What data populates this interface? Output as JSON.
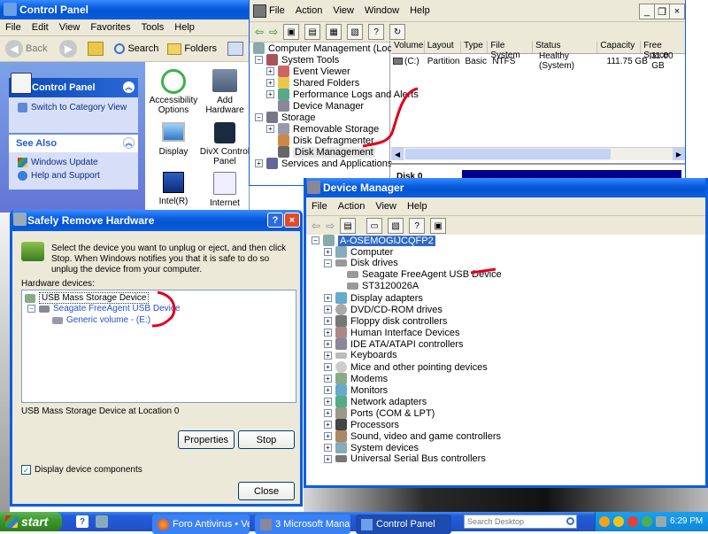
{
  "control_panel": {
    "title": "Control Panel",
    "menu": [
      "File",
      "Edit",
      "View",
      "Favorites",
      "Tools",
      "Help"
    ],
    "toolbar": {
      "back": "Back",
      "search": "Search",
      "folders": "Folders"
    },
    "side_panel": {
      "header": "Control Panel",
      "switch_link": "Switch to Category View"
    },
    "see_also": {
      "header": "See Also",
      "items": [
        "Windows Update",
        "Help and Support"
      ]
    },
    "items": [
      {
        "label": "Accessibility Options",
        "icon": "accessibility-icon"
      },
      {
        "label": "Add Hardware",
        "icon": "add-hardware-icon"
      },
      {
        "label": "Display",
        "icon": "display-icon"
      },
      {
        "label": "DivX Control Panel",
        "icon": "divx-icon"
      },
      {
        "label": "Intel(R)",
        "icon": "intel-icon"
      },
      {
        "label": "Internet",
        "icon": "internet-icon"
      }
    ]
  },
  "computer_mgmt": {
    "menu": [
      "File",
      "Action",
      "View",
      "Window",
      "Help"
    ],
    "tree": [
      "Computer Management (Local)",
      "System Tools",
      "Event Viewer",
      "Shared Folders",
      "Performance Logs and Alerts",
      "Device Manager",
      "Storage",
      "Removable Storage",
      "Disk Defragmenter",
      "Disk Management",
      "Services and Applications"
    ],
    "columns": [
      "Volume",
      "Layout",
      "Type",
      "File System",
      "Status",
      "Capacity",
      "Free Space"
    ],
    "rows": [
      [
        "(C:)",
        "Partition",
        "Basic",
        "NTFS",
        "Healthy (System)",
        "111.75 GB",
        "11.00 GB"
      ]
    ],
    "disk_label": "Disk 0"
  },
  "safely_remove": {
    "title": "Safely Remove Hardware",
    "instruction": "Select the device you want to unplug or eject, and then click Stop. When Windows notifies you that it is safe to do so unplug the device from your computer.",
    "devices_label": "Hardware devices:",
    "devices": [
      "USB Mass Storage Device",
      "Seagate FreeAgent USB Device",
      "Generic volume - (E:)"
    ],
    "status": "USB Mass Storage Device at Location 0",
    "properties_btn": "Properties",
    "stop_btn": "Stop",
    "checkbox_label": "Display device components",
    "close_btn": "Close",
    "help_glyph": "?",
    "close_glyph": "×"
  },
  "device_manager": {
    "title": "Device Manager",
    "menu": [
      "File",
      "Action",
      "View",
      "Help"
    ],
    "root": "A-OSEMOGIJCQFP2",
    "items": [
      "Computer",
      "Disk drives",
      "Seagate FreeAgent USB Device",
      "ST3120026A",
      "Display adapters",
      "DVD/CD-ROM drives",
      "Floppy disk controllers",
      "Human Interface Devices",
      "IDE ATA/ATAPI controllers",
      "Keyboards",
      "Mice and other pointing devices",
      "Modems",
      "Monitors",
      "Network adapters",
      "Ports (COM & LPT)",
      "Processors",
      "Sound, video and game controllers",
      "System devices",
      "Universal Serial Bus controllers"
    ]
  },
  "taskbar": {
    "start": "start",
    "help_glyph": "?",
    "buttons": [
      "Foro Antivirus • Ve...",
      "3 Microsoft Mana...",
      "Control Panel"
    ],
    "search_placeholder": "Search Desktop",
    "clock": "6:29 PM"
  },
  "colors": {
    "xp_blue": "#0a5ee0",
    "taskbar": "#245edb",
    "start": "#3c9a2c",
    "annotation": "#e0001b"
  }
}
